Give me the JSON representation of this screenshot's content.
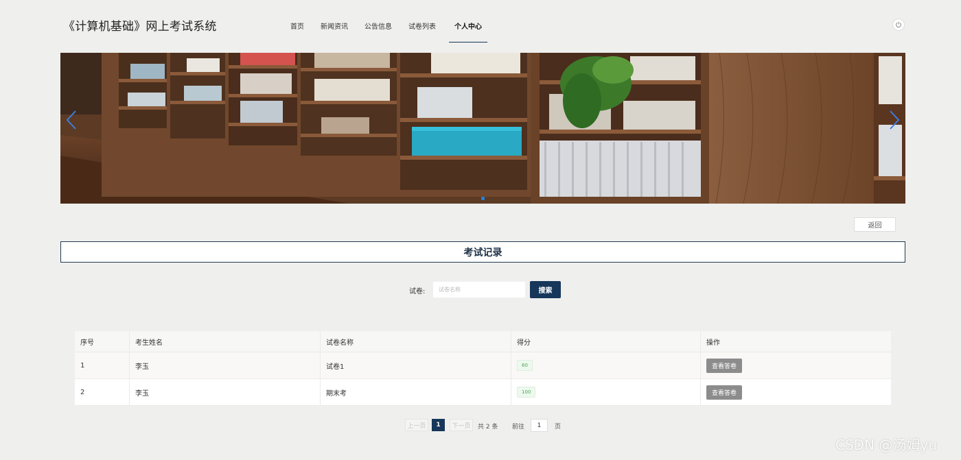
{
  "header": {
    "site_title": "《计算机基础》网上考试系统",
    "nav": [
      "首页",
      "新闻资讯",
      "公告信息",
      "试卷列表",
      "个人中心"
    ],
    "active_nav": "个人中心"
  },
  "banner": {
    "slide_count": 1,
    "active_slide": 1
  },
  "actions": {
    "back_label": "返回"
  },
  "section": {
    "title": "考试记录"
  },
  "search": {
    "label": "试卷:",
    "placeholder": "试卷名称",
    "button_label": "搜索"
  },
  "table": {
    "columns": [
      "序号",
      "考生姓名",
      "试卷名称",
      "得分",
      "操作"
    ],
    "rows": [
      {
        "index": "1",
        "name": "李玉",
        "paper": "试卷1",
        "score": "60",
        "action": "查看答卷"
      },
      {
        "index": "2",
        "name": "李玉",
        "paper": "期末考",
        "score": "100",
        "action": "查看答卷"
      }
    ]
  },
  "pagination": {
    "prev_label": "上一页",
    "current_page": "1",
    "next_label": "下一页",
    "total_text": "共 2 条",
    "goto_label": "前往",
    "goto_value": "1",
    "page_suffix": "页"
  },
  "watermark": "CSDN @汤姆yu",
  "colors": {
    "primary": "#16375a",
    "score_green": "#4da456",
    "view_button": "#8c8c8c",
    "background": "#efefed"
  }
}
